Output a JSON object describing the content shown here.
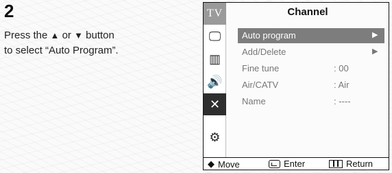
{
  "instruction": {
    "step_number": "2",
    "line1_pre": "Press the ",
    "up_glyph": "▲",
    "mid": " or ",
    "down_glyph": "▼",
    "line1_post": " button",
    "line2": "to select “Auto Program”."
  },
  "osd": {
    "title": "Channel",
    "side_icons": [
      {
        "name": "tv-icon",
        "label": "TV",
        "glyph": "TV"
      },
      {
        "name": "picture-icon",
        "glyph": "🖵"
      },
      {
        "name": "channel-icon",
        "glyph": "▥"
      },
      {
        "name": "sound-icon",
        "glyph": "🔊"
      },
      {
        "name": "setup-icon",
        "glyph": "✕"
      },
      {
        "name": "input-icon",
        "glyph": "⚙"
      }
    ],
    "menu_items": [
      {
        "label": "Auto program",
        "value": "",
        "arrow": "▶",
        "selected": true
      },
      {
        "label": "Add/Delete",
        "value": "",
        "arrow": "▶",
        "selected": false
      },
      {
        "label": "Fine tune",
        "value": ":    00",
        "arrow": "",
        "selected": false
      },
      {
        "label": "Air/CATV",
        "value": ":   Air",
        "arrow": "",
        "selected": false
      },
      {
        "label": "Name",
        "value": ":  ----",
        "arrow": "",
        "selected": false
      }
    ],
    "footer": {
      "move_glyph": "◆",
      "move_label": "Move",
      "enter_label": "Enter",
      "return_label": "Return"
    }
  },
  "colors": {
    "selected_row": "#7d7d7d",
    "tv_tile": "#9a9a9a",
    "dark_tile": "#2e2e2e"
  }
}
